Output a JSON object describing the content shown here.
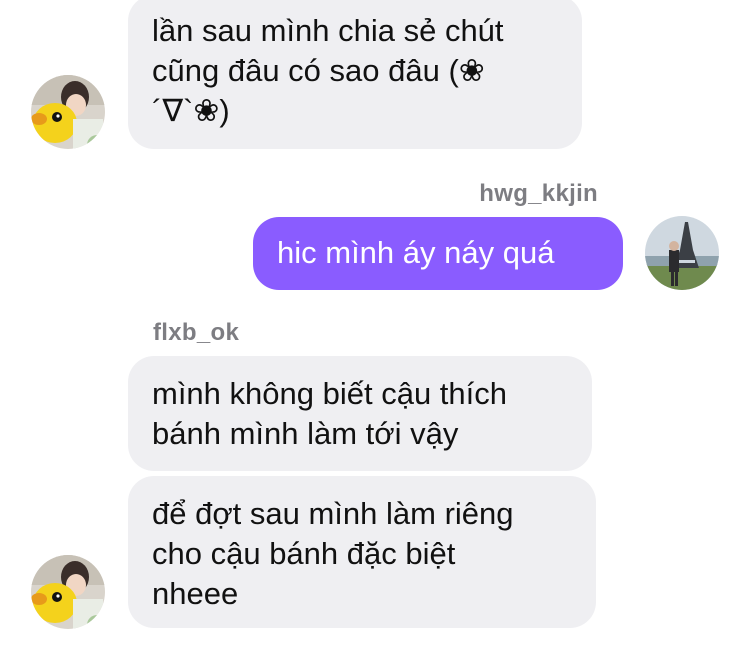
{
  "conversation": {
    "messages": [
      {
        "sender": "",
        "direction": "incoming",
        "text": "lần sau mình chia sẻ chút\ncũng đâu có sao đâu (❀\n´∇`❀)"
      },
      {
        "sender": "hwg_kkjin",
        "direction": "outgoing",
        "text": "hic mình áy náy quá"
      },
      {
        "sender": "flxb_ok",
        "direction": "incoming",
        "text": "mình không biết cậu thích\nbánh mình làm tới vậy"
      },
      {
        "sender": "",
        "direction": "incoming",
        "text": "để đợt sau mình làm riêng\ncho cậu bánh đặc biệt\nnheee"
      }
    ]
  },
  "colors": {
    "incoming_bubble": "#efeff2",
    "outgoing_bubble": "#8a5cff",
    "sender_name": "#7d7d82"
  },
  "icons": {
    "incoming_avatar": "avatar-photo-boy-with-yellow-duck",
    "outgoing_avatar": "avatar-photo-eiffel-tower"
  }
}
